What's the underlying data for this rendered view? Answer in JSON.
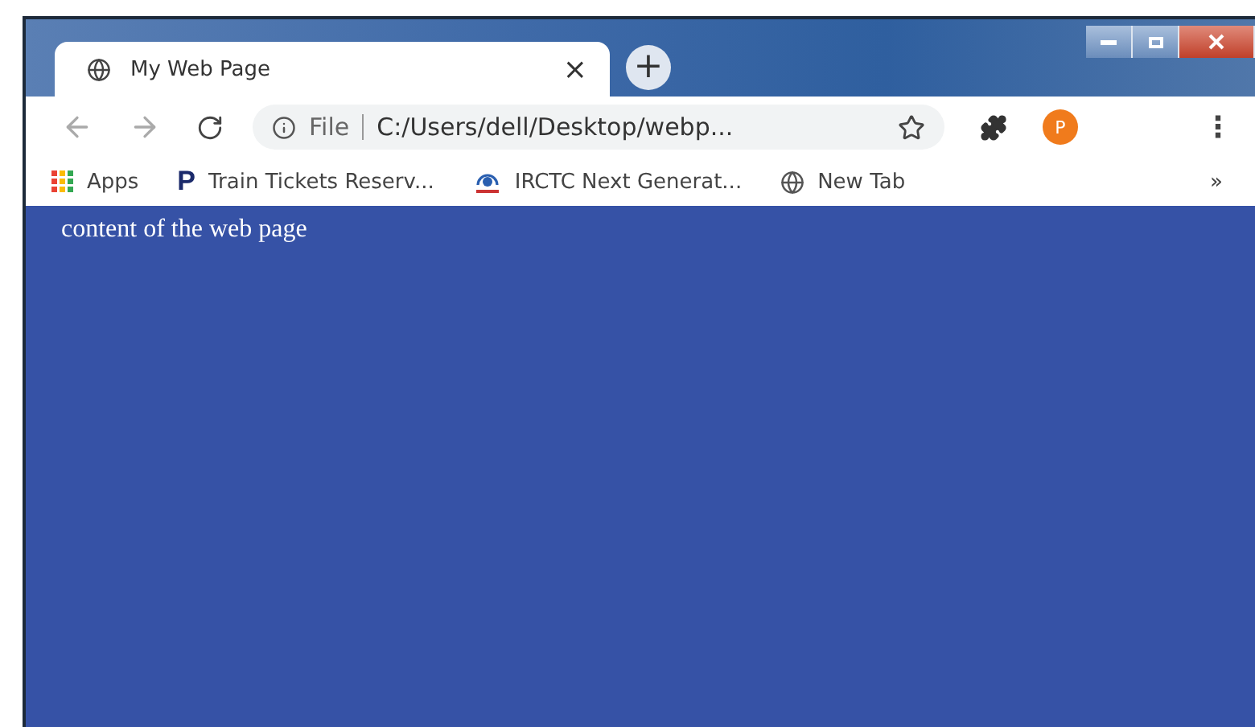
{
  "tabs": [
    {
      "title": "My Web Page",
      "close": "×",
      "selected": true
    }
  ],
  "new_tab": "+",
  "address": {
    "scheme": "File",
    "url": "C:/Users/dell/Desktop/webp..."
  },
  "avatar": "P",
  "menu": "⋮",
  "bookmarks": [
    {
      "kind": "apps",
      "label": "Apps"
    },
    {
      "kind": "letter",
      "mark": "P",
      "label": "Train Tickets Reserv..."
    },
    {
      "kind": "irctc",
      "label": "IRCTC Next Generat..."
    },
    {
      "kind": "globe",
      "label": "New Tab"
    }
  ],
  "overflow": "»",
  "content": "content of the web page"
}
